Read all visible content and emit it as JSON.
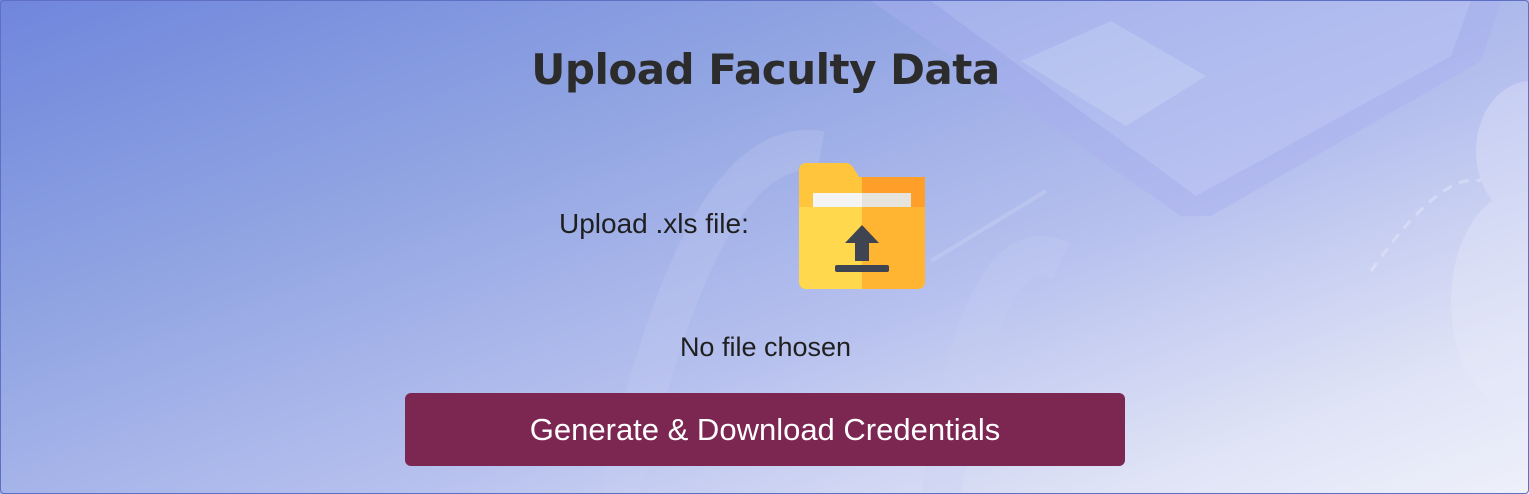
{
  "page": {
    "title": "Upload Faculty Data"
  },
  "upload": {
    "label": "Upload .xls file:",
    "icon": "folder-upload-icon",
    "status_text": "No file chosen"
  },
  "actions": {
    "generate_label": "Generate & Download Credentials"
  },
  "colors": {
    "button_bg": "#7c2652",
    "title_color": "#2c2c2c",
    "folder_yellow": "#ffd84d",
    "folder_orange": "#ffb531"
  }
}
